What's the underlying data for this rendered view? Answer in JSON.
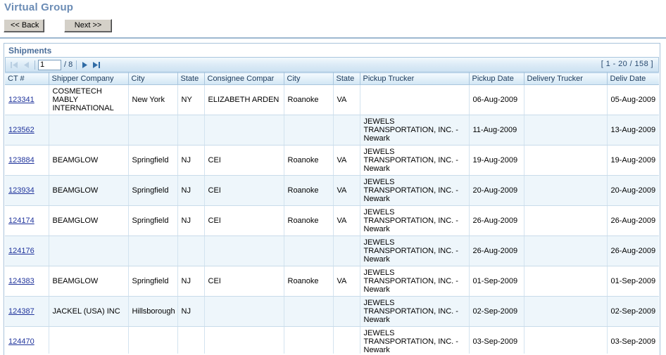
{
  "page": {
    "title": "Virtual Group"
  },
  "nav": {
    "back_label": "<< Back",
    "next_label": "Next >>"
  },
  "panel": {
    "title": "Shipments"
  },
  "pager": {
    "first_icon": "first-page-icon",
    "prev_icon": "previous-page-icon",
    "next_icon": "next-page-icon",
    "last_icon": "last-page-icon",
    "current_page": "1",
    "total_pages": "/ 8",
    "range_label": "[ 1 - 20 / 158 ]"
  },
  "grid": {
    "columns": [
      "CT #",
      "Shipper Company",
      "City",
      "State",
      "Consignee Compar",
      "City",
      "State",
      "Pickup Trucker",
      "Pickup Date",
      "Delivery Trucker",
      "Deliv Date"
    ],
    "rows": [
      {
        "ct": "123341",
        "shipper_company": "COSMETECH MABLY INTERNATIONAL",
        "shipper_city": "New York",
        "shipper_state": "NY",
        "consignee_company": "ELIZABETH ARDEN",
        "consignee_city": "Roanoke",
        "consignee_state": "VA",
        "pickup_trucker": "",
        "pickup_date": "06-Aug-2009",
        "delivery_trucker": "",
        "deliv_date": "05-Aug-2009"
      },
      {
        "ct": "123562",
        "shipper_company": "",
        "shipper_city": "",
        "shipper_state": "",
        "consignee_company": "",
        "consignee_city": "",
        "consignee_state": "",
        "pickup_trucker": "JEWELS TRANSPORTATION, INC. - Newark",
        "pickup_date": "11-Aug-2009",
        "delivery_trucker": "",
        "deliv_date": "13-Aug-2009"
      },
      {
        "ct": "123884",
        "shipper_company": "BEAMGLOW",
        "shipper_city": "Springfield",
        "shipper_state": "NJ",
        "consignee_company": "CEI",
        "consignee_city": "Roanoke",
        "consignee_state": "VA",
        "pickup_trucker": "JEWELS TRANSPORTATION, INC. - Newark",
        "pickup_date": "19-Aug-2009",
        "delivery_trucker": "",
        "deliv_date": "19-Aug-2009"
      },
      {
        "ct": "123934",
        "shipper_company": "BEAMGLOW",
        "shipper_city": "Springfield",
        "shipper_state": "NJ",
        "consignee_company": "CEI",
        "consignee_city": "Roanoke",
        "consignee_state": "VA",
        "pickup_trucker": "JEWELS TRANSPORTATION, INC. - Newark",
        "pickup_date": "20-Aug-2009",
        "delivery_trucker": "",
        "deliv_date": "20-Aug-2009"
      },
      {
        "ct": "124174",
        "shipper_company": "BEAMGLOW",
        "shipper_city": "Springfield",
        "shipper_state": "NJ",
        "consignee_company": "CEI",
        "consignee_city": "Roanoke",
        "consignee_state": "VA",
        "pickup_trucker": "JEWELS TRANSPORTATION, INC. - Newark",
        "pickup_date": "26-Aug-2009",
        "delivery_trucker": "",
        "deliv_date": "26-Aug-2009"
      },
      {
        "ct": "124176",
        "shipper_company": "",
        "shipper_city": "",
        "shipper_state": "",
        "consignee_company": "",
        "consignee_city": "",
        "consignee_state": "",
        "pickup_trucker": "JEWELS TRANSPORTATION, INC. - Newark",
        "pickup_date": "26-Aug-2009",
        "delivery_trucker": "",
        "deliv_date": "26-Aug-2009"
      },
      {
        "ct": "124383",
        "shipper_company": "BEAMGLOW",
        "shipper_city": "Springfield",
        "shipper_state": "NJ",
        "consignee_company": "CEI",
        "consignee_city": "Roanoke",
        "consignee_state": "VA",
        "pickup_trucker": "JEWELS TRANSPORTATION, INC. - Newark",
        "pickup_date": "01-Sep-2009",
        "delivery_trucker": "",
        "deliv_date": "01-Sep-2009"
      },
      {
        "ct": "124387",
        "shipper_company": "JACKEL (USA) INC",
        "shipper_city": "Hillsborough",
        "shipper_state": "NJ",
        "consignee_company": "",
        "consignee_city": "",
        "consignee_state": "",
        "pickup_trucker": "JEWELS TRANSPORTATION, INC. - Newark",
        "pickup_date": "02-Sep-2009",
        "delivery_trucker": "",
        "deliv_date": "02-Sep-2009"
      },
      {
        "ct": "124470",
        "shipper_company": "",
        "shipper_city": "",
        "shipper_state": "",
        "consignee_company": "",
        "consignee_city": "",
        "consignee_state": "",
        "pickup_trucker": "JEWELS TRANSPORTATION, INC. - Newark",
        "pickup_date": "03-Sep-2009",
        "delivery_trucker": "",
        "deliv_date": "03-Sep-2009"
      }
    ]
  },
  "colors": {
    "title_blue": "#6b8cb5",
    "panel_title_blue": "#4a6d99",
    "link_blue": "#20349c",
    "header_blue": "#d2e6f4",
    "row_alt": "#eef6fb",
    "divider": "#9db8d0"
  }
}
